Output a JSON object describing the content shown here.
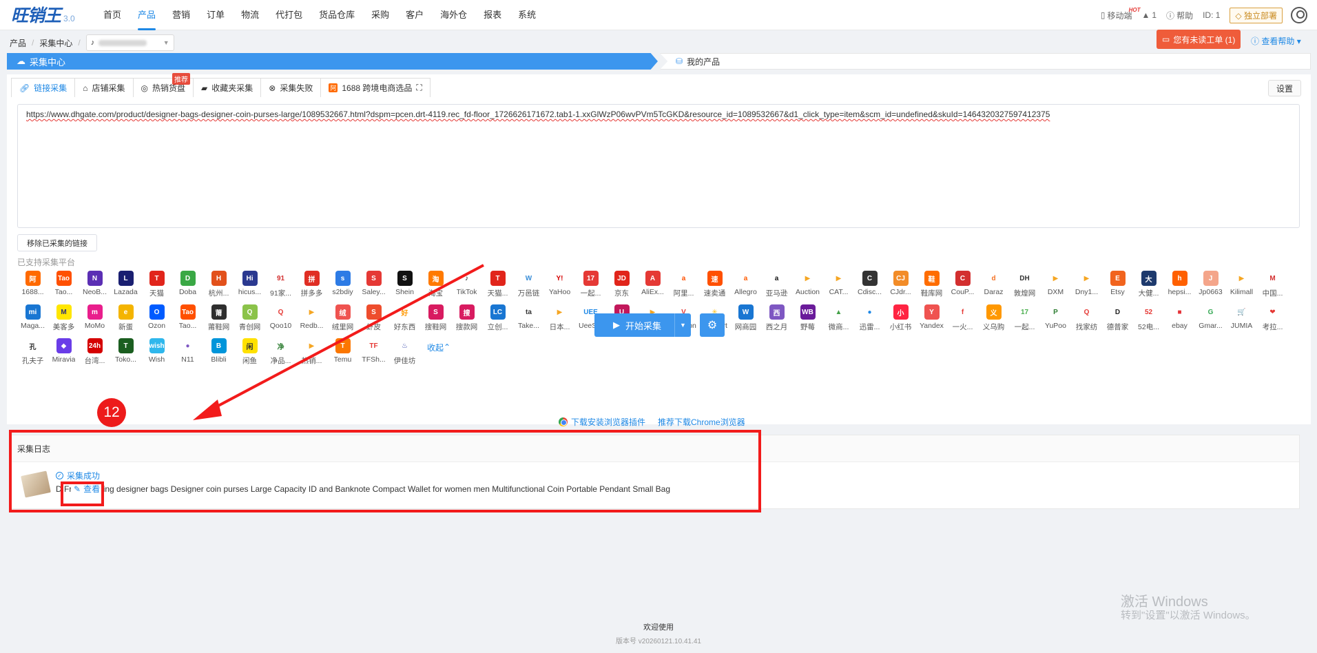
{
  "app": {
    "logo": "旺销王",
    "version": "3.0"
  },
  "nav": [
    "首页",
    "产品",
    "营销",
    "订单",
    "物流",
    "代打包",
    "货品仓库",
    "采购",
    "客户",
    "海外仓",
    "报表",
    "系统"
  ],
  "nav_active": 1,
  "topright": {
    "mobile": "移动端",
    "hot": "HOT",
    "warning_count": "1",
    "help": "帮助",
    "id_label": "ID: 1",
    "deploy": "独立部署"
  },
  "breadcrumb": [
    "产品",
    "采集中心"
  ],
  "ticket": "您有未读工单 (1)",
  "view_help": "查看帮助",
  "steps": {
    "collect_center": "采集中心",
    "my_products": "我的产品"
  },
  "tabs": [
    "链接采集",
    "店铺采集",
    "热销货盘",
    "收藏夹采集",
    "采集失败",
    "1688 跨境电商选品"
  ],
  "tab_badge": "推荐",
  "settings": "设置",
  "url_text": "https://www.dhgate.com/product/designer-bags-designer-coin-purses-large/1089532667.html?dspm=pcen.drt-4119.rec_fd-floor_1726626171672.tab1-1.xxGlWzP06wvPVm5TcGKD&resource_id=1089532667&d1_click_type=item&scm_id=undefined&skuId=1464320327597412375",
  "remove_btn": "移除已采集的链接",
  "supported_label": "已支持采集平台",
  "platforms": [
    {
      "name": "1688...",
      "color": "#ff6a00",
      "g": "阿"
    },
    {
      "name": "Tao...",
      "color": "#ff5000",
      "g": "Tao"
    },
    {
      "name": "NeoB...",
      "color": "#5b2fb4",
      "g": "N"
    },
    {
      "name": "Lazada",
      "color": "#1a1f71",
      "g": "L"
    },
    {
      "name": "天猫",
      "color": "#e1251b",
      "g": "T"
    },
    {
      "name": "Doba",
      "color": "#3aa845",
      "g": "D"
    },
    {
      "name": "杭州...",
      "color": "#e2511b",
      "g": "H"
    },
    {
      "name": "hicus...",
      "color": "#2b3990",
      "g": "Hi"
    },
    {
      "name": "91家...",
      "color": "#ffffff",
      "g": "91",
      "fg": "#d32f2f"
    },
    {
      "name": "拼多多",
      "color": "#e02e24",
      "g": "拼"
    },
    {
      "name": "s2bdiy",
      "color": "#2d7be5",
      "g": "s"
    },
    {
      "name": "Saley...",
      "color": "#e53935",
      "g": "S"
    },
    {
      "name": "Shein",
      "color": "#111111",
      "g": "S"
    },
    {
      "name": "淘宝",
      "color": "#ff7a00",
      "g": "淘"
    },
    {
      "name": "TikTok",
      "color": "#ffffff",
      "g": "♪",
      "fg": "#111"
    },
    {
      "name": "天猫...",
      "color": "#e1251b",
      "g": "T"
    },
    {
      "name": "万邑链",
      "color": "#ffffff",
      "g": "W",
      "fg": "#3a8ed8"
    },
    {
      "name": "YaHoo",
      "color": "#ffffff",
      "g": "Y!",
      "fg": "#d50000"
    },
    {
      "name": "一起...",
      "color": "#e53935",
      "g": "17"
    },
    {
      "name": "京东",
      "color": "#e1251b",
      "g": "JD"
    },
    {
      "name": "AliEx...",
      "color": "#e53935",
      "g": "A"
    },
    {
      "name": "阿里...",
      "color": "#ffffff",
      "g": "a",
      "fg": "#ff5000"
    },
    {
      "name": "速卖通",
      "color": "#ff5000",
      "g": "速"
    },
    {
      "name": "Allegro",
      "color": "#ffffff",
      "g": "a",
      "fg": "#ff5a00"
    },
    {
      "name": "亚马逊",
      "color": "#ffffff",
      "g": "a",
      "fg": "#111"
    },
    {
      "name": "Auction",
      "color": "#ffffff",
      "g": "▶",
      "fg": "#f5a623"
    },
    {
      "name": "CAT...",
      "color": "#ffffff",
      "g": "▶",
      "fg": "#f5a623"
    },
    {
      "name": "Cdisc...",
      "color": "#333333",
      "g": "C"
    },
    {
      "name": "CJdr...",
      "color": "#f28c28",
      "g": "CJ"
    },
    {
      "name": "鞋库网",
      "color": "#ff6d00",
      "g": "鞋"
    },
    {
      "name": "CouP...",
      "color": "#d32f2f",
      "g": "C"
    },
    {
      "name": "Daraz",
      "color": "#ffffff",
      "g": "d",
      "fg": "#f57224"
    },
    {
      "name": "敦煌网",
      "color": "#ffffff",
      "g": "DH",
      "fg": "#333"
    },
    {
      "name": "DXM",
      "color": "#ffffff",
      "g": "▶",
      "fg": "#f5a623"
    },
    {
      "name": "Dny1...",
      "color": "#ffffff",
      "g": "▶",
      "fg": "#f5a623"
    },
    {
      "name": "Etsy",
      "color": "#f1641e",
      "g": "E"
    },
    {
      "name": "大健...",
      "color": "#1e3a6d",
      "g": "大"
    },
    {
      "name": "hepsi...",
      "color": "#ff6000",
      "g": "h"
    },
    {
      "name": "Jp0663",
      "color": "#f4a58a",
      "g": "J"
    },
    {
      "name": "Kilimall",
      "color": "#ffffff",
      "g": "▶",
      "fg": "#f5a623"
    },
    {
      "name": "中国...",
      "color": "#ffffff",
      "g": "M",
      "fg": "#d32f2f"
    },
    {
      "name": "Maga...",
      "color": "#1976d2",
      "g": "mi"
    },
    {
      "name": "美客多",
      "color": "#ffe600",
      "g": "M",
      "fg": "#2d3277"
    },
    {
      "name": "MoMo",
      "color": "#e91e8c",
      "g": "m"
    },
    {
      "name": "新蛋",
      "color": "#f4b400",
      "g": "e"
    },
    {
      "name": "Ozon",
      "color": "#005bff",
      "g": "O"
    },
    {
      "name": "Tao...",
      "color": "#ff5000",
      "g": "Tao"
    },
    {
      "name": "莆鞋网",
      "color": "#2e2e2e",
      "g": "莆"
    },
    {
      "name": "青创网",
      "color": "#8bc34a",
      "g": "Q"
    },
    {
      "name": "Qoo10",
      "color": "#ffffff",
      "g": "Q",
      "fg": "#e53935"
    },
    {
      "name": "Redb...",
      "color": "#ffffff",
      "g": "▶",
      "fg": "#f5a623"
    },
    {
      "name": "绒里网",
      "color": "#ef5350",
      "g": "绒"
    },
    {
      "name": "虾皮",
      "color": "#ee4d2d",
      "g": "S"
    },
    {
      "name": "好东西",
      "color": "#ffffff",
      "g": "好",
      "fg": "#ff9800"
    },
    {
      "name": "搜鞋网",
      "color": "#d81b60",
      "g": "S"
    },
    {
      "name": "搜款网",
      "color": "#d81b60",
      "g": "搜"
    },
    {
      "name": "立创...",
      "color": "#1976d2",
      "g": "LC"
    },
    {
      "name": "Take...",
      "color": "#ffffff",
      "g": "ta",
      "fg": "#333"
    },
    {
      "name": "日本...",
      "color": "#ffffff",
      "g": "▶",
      "fg": "#f5a623"
    },
    {
      "name": "UeeS...",
      "color": "#ffffff",
      "g": "UEE",
      "fg": "#1e88e5"
    },
    {
      "name": "Usho...",
      "color": "#c2185b",
      "g": "U"
    },
    {
      "name": "VipS...",
      "color": "#ffffff",
      "g": "▶",
      "fg": "#f5a623"
    },
    {
      "name": "voghion",
      "color": "#ffffff",
      "g": "V",
      "fg": "#e53935"
    },
    {
      "name": "walmart",
      "color": "#ffffff",
      "g": "✳",
      "fg": "#ffc220"
    },
    {
      "name": "网商园",
      "color": "#1976d2",
      "g": "W"
    },
    {
      "name": "西之月",
      "color": "#7e57c2",
      "g": "西"
    },
    {
      "name": "野莓",
      "color": "#6a1b9a",
      "g": "WB"
    },
    {
      "name": "微商...",
      "color": "#ffffff",
      "g": "▲",
      "fg": "#43a047"
    },
    {
      "name": "迅雷...",
      "color": "#ffffff",
      "g": "●",
      "fg": "#1e88e5"
    },
    {
      "name": "小红书",
      "color": "#ff2442",
      "g": "小"
    },
    {
      "name": "Yandex",
      "color": "#ef5350",
      "g": "Y"
    },
    {
      "name": "一火...",
      "color": "#ffffff",
      "g": "f",
      "fg": "#e53935"
    },
    {
      "name": "义乌购",
      "color": "#ff9800",
      "g": "义"
    },
    {
      "name": "一起...",
      "color": "#ffffff",
      "g": "17",
      "fg": "#4caf50"
    },
    {
      "name": "YuPoo",
      "color": "#ffffff",
      "g": "P",
      "fg": "#2e7d32"
    },
    {
      "name": "找家纺",
      "color": "#ffffff",
      "g": "Q",
      "fg": "#e53935"
    },
    {
      "name": "德普家",
      "color": "#ffffff",
      "g": "D",
      "fg": "#222"
    },
    {
      "name": "52电...",
      "color": "#ffffff",
      "g": "52",
      "fg": "#e53935"
    },
    {
      "name": "ebay",
      "color": "#ffffff",
      "g": "■",
      "fg": "#e53238"
    },
    {
      "name": "Gmar...",
      "color": "#ffffff",
      "g": "G",
      "fg": "#34a853"
    },
    {
      "name": "JUMIA",
      "color": "#ffffff",
      "g": "🛒",
      "fg": "#f68b1e"
    },
    {
      "name": "考拉...",
      "color": "#ffffff",
      "g": "❤",
      "fg": "#e53935"
    },
    {
      "name": "孔夫子",
      "color": "#ffffff",
      "g": "孔",
      "fg": "#333"
    },
    {
      "name": "Miravia",
      "color": "#6a3de8",
      "g": "◆"
    },
    {
      "name": "台湾...",
      "color": "#d50000",
      "g": "24h"
    },
    {
      "name": "Toko...",
      "color": "#1b5e20",
      "g": "T"
    },
    {
      "name": "Wish",
      "color": "#2fb7ec",
      "g": "wish"
    },
    {
      "name": "N11",
      "color": "#ffffff",
      "g": "●",
      "fg": "#7e57c2"
    },
    {
      "name": "Blibli",
      "color": "#0095da",
      "g": "B"
    },
    {
      "name": "闲鱼",
      "color": "#ffe100",
      "g": "闲",
      "fg": "#333"
    },
    {
      "name": "净品...",
      "color": "#ffffff",
      "g": "净",
      "fg": "#2e7d32"
    },
    {
      "name": "热销...",
      "color": "#ffffff",
      "g": "▶",
      "fg": "#f5a623"
    },
    {
      "name": "Temu",
      "color": "#fb7701",
      "g": "T"
    },
    {
      "name": "TFSh...",
      "color": "#ffffff",
      "g": "TF",
      "fg": "#e53935"
    },
    {
      "name": "伊佳坊",
      "color": "#ffffff",
      "g": "♨",
      "fg": "#3949ab"
    }
  ],
  "collapse": "收起",
  "start": "开始采集",
  "links": {
    "plugin": "下载安装浏览器插件",
    "chrome": "推荐下载Chrome浏览器"
  },
  "log": {
    "title": "采集日志",
    "status": "采集成功",
    "product_title": "Free shipping designer bags Designer coin purses Large Capacity ID and Banknote Compact Wallet for women men Multifunctional Coin Portable Pendant Small Bag",
    "view": "查看"
  },
  "annotation": {
    "step": "12",
    "color": "#f21b1b"
  },
  "footer": {
    "welcome": "欢迎使用",
    "version": "版本号 v20260121.10.41.41"
  },
  "watermark": {
    "line1": "激活 Windows",
    "line2": "转到\"设置\"以激活 Windows。"
  }
}
